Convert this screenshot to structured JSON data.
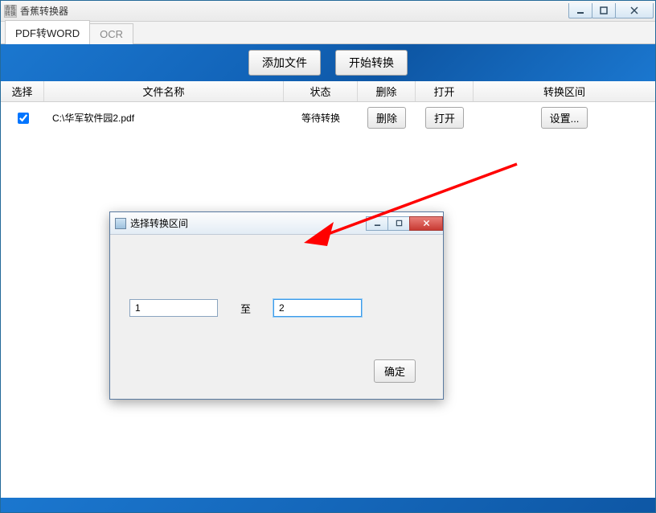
{
  "window": {
    "title": "香蕉转换器",
    "app_icon_text": "香蕉\n转换"
  },
  "tabs": [
    {
      "label": "PDF转WORD",
      "active": true
    },
    {
      "label": "OCR",
      "active": false
    }
  ],
  "toolbar": {
    "add_file": "添加文件",
    "start_convert": "开始转换"
  },
  "columns": {
    "select": "选择",
    "name": "文件名称",
    "status": "状态",
    "delete": "删除",
    "open": "打开",
    "range": "转换区间"
  },
  "rows": [
    {
      "checked": true,
      "name": "C:\\华军软件园2.pdf",
      "status": "等待转换",
      "delete_label": "删除",
      "open_label": "打开",
      "range_label": "设置..."
    }
  ],
  "dialog": {
    "title": "选择转换区间",
    "from_value": "1",
    "to_value": "2",
    "to_text": "至",
    "ok": "确定"
  }
}
